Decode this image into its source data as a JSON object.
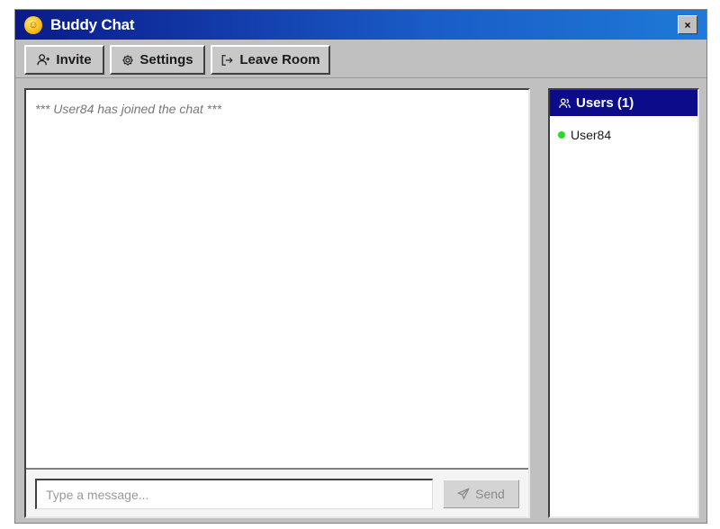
{
  "window": {
    "title": "Buddy Chat",
    "close_label": "×",
    "title_gradient": [
      "#0a1a8a",
      "#1e7ad6"
    ]
  },
  "toolbar": {
    "invite_label": "Invite",
    "settings_label": "Settings",
    "leave_label": "Leave Room"
  },
  "chat": {
    "messages": [
      {
        "type": "system",
        "text": "*** User84 has joined the chat ***"
      }
    ],
    "input_placeholder": "Type a message...",
    "input_value": "",
    "send_label": "Send",
    "send_enabled": false
  },
  "users": {
    "header_label": "Users (1)",
    "header_color": "#0c0c8a",
    "list": [
      {
        "name": "User84",
        "status": "online",
        "status_color": "#22dd22"
      }
    ]
  },
  "icons": {
    "app": "buddy-smiley-icon",
    "invite": "user-plus-icon",
    "settings": "gear-icon",
    "leave": "exit-icon",
    "send": "paper-plane-icon",
    "users": "users-icon"
  }
}
